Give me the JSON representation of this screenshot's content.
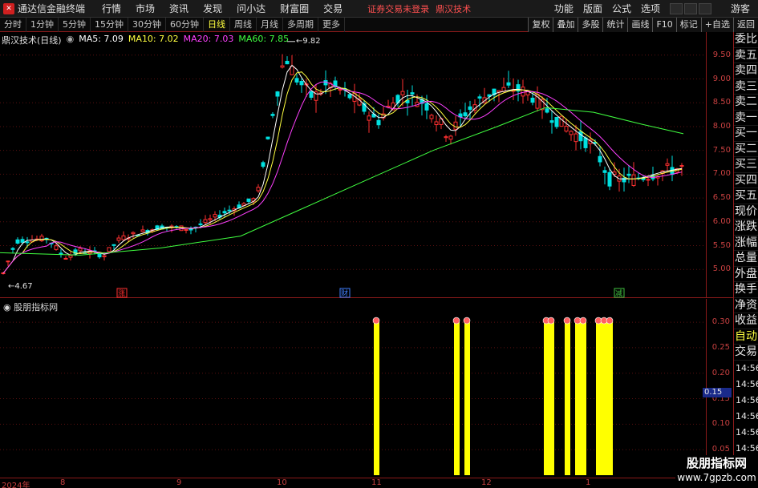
{
  "app": {
    "title": "通达信金融终端",
    "menu": [
      "行情",
      "市场",
      "资讯",
      "发现",
      "问小达",
      "财富圈",
      "交易"
    ],
    "broker_status": "证券交易未登录",
    "broker_name": "鼎汉技术",
    "right_menu": [
      "功能",
      "版面",
      "公式",
      "选项"
    ],
    "guest": "游客"
  },
  "periods": {
    "tabs": [
      "分时",
      "1分钟",
      "5分钟",
      "15分钟",
      "30分钟",
      "60分钟",
      "日线",
      "周线",
      "月线",
      "多周期",
      "更多"
    ],
    "active": "日线"
  },
  "tools": [
    "复权",
    "叠加",
    "多股",
    "统计",
    "画线",
    "F10",
    "标记",
    "+自选",
    "返回"
  ],
  "chart": {
    "stock_title": "鼎汉技术(日线)",
    "ma5": "MA5: 7.09",
    "ma10": "MA10: 7.02",
    "ma20": "MA20: 7.03",
    "ma60": "MA60: 7.85",
    "high_label": "9.82",
    "low_label": "4.67",
    "price_ticks": [
      "9.50",
      "9.00",
      "8.50",
      "8.00",
      "7.50",
      "7.00",
      "6.50",
      "6.00",
      "5.50",
      "5.00"
    ],
    "markers": [
      "涨",
      "财",
      "减"
    ],
    "colors": {
      "up": "#ff3030",
      "down": "#00e0e0",
      "ma5": "#ffffff",
      "ma10": "#ffff40",
      "ma20": "#ff40ff",
      "ma60": "#40ff40"
    }
  },
  "indicator": {
    "title": "股朋指标网",
    "ticks": [
      "0.30",
      "0.25",
      "0.20",
      "0.15",
      "0.10",
      "0.05"
    ],
    "current": "0.15",
    "bar_color": "#ffff00"
  },
  "date_axis": [
    "2024年",
    "8",
    "9",
    "10",
    "11",
    "12",
    "1"
  ],
  "right_panel": {
    "items": [
      "委比",
      "卖五",
      "卖四",
      "卖三",
      "卖二",
      "卖一",
      "买一",
      "买二",
      "买三",
      "买四",
      "买五",
      "现价",
      "涨跌",
      "涨幅",
      "总量",
      "外盘",
      "换手",
      "净资",
      "收益"
    ],
    "auto_label": "自动",
    "trade_label": "交易",
    "times": [
      "14:56",
      "14:56",
      "14:56",
      "14:56",
      "14:56",
      "14:56",
      "14:56",
      "14:56"
    ]
  },
  "watermark": {
    "line1": "股朋指标网",
    "line2": "www.7gpzb.com"
  }
}
